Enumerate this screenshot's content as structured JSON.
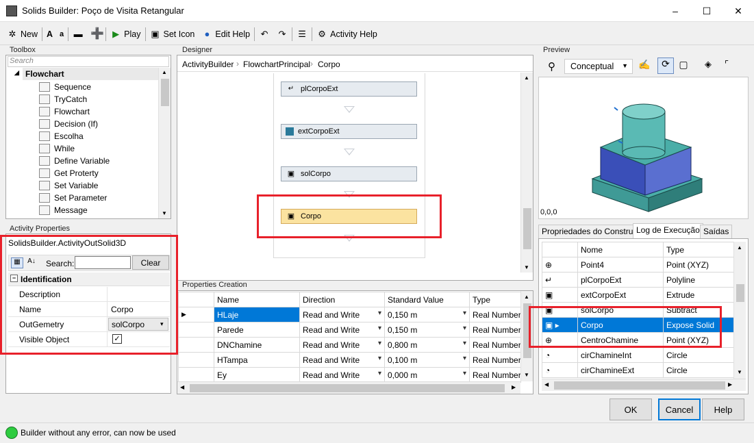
{
  "window": {
    "title": "Solids Builder: Poço de Visita Retangular"
  },
  "toolbar": {
    "new_label": "New",
    "font_a_upper": "A",
    "font_a_lower": "a",
    "play_label": "Play",
    "set_icon_label": "Set Icon",
    "edit_help_label": "Edit Help",
    "activity_help_label": "Activity Help"
  },
  "toolbox": {
    "label": "Toolbox",
    "search_placeholder": "Search",
    "group": "Flowchart",
    "items": [
      {
        "label": "Sequence",
        "icon": "sequence-icon"
      },
      {
        "label": "TryCatch",
        "icon": "trycatch-icon"
      },
      {
        "label": "Flowchart",
        "icon": "flowchart-icon"
      },
      {
        "label": "Decision (If)",
        "icon": "decision-icon"
      },
      {
        "label": "Escolha",
        "icon": "switch-icon"
      },
      {
        "label": "While",
        "icon": "while-icon"
      },
      {
        "label": "Define Variable",
        "icon": "variable-icon"
      },
      {
        "label": "Get Proterty",
        "icon": "get-property-icon"
      },
      {
        "label": "Set Variable",
        "icon": "set-variable-icon"
      },
      {
        "label": "Set Parameter",
        "icon": "set-parameter-icon"
      },
      {
        "label": "Message",
        "icon": "message-icon"
      }
    ]
  },
  "activity_properties": {
    "label": "Activity Properties",
    "type_name": "SolidsBuilder.ActivityOutSolid3D",
    "search_label": "Search:",
    "clear_label": "Clear",
    "category": "Identification",
    "rows": [
      {
        "name": "Description",
        "value": ""
      },
      {
        "name": "Name",
        "value": "Corpo"
      },
      {
        "name": "OutGemetry",
        "value": "solCorpo"
      },
      {
        "name": "Visible Object",
        "value": "✓"
      }
    ]
  },
  "designer": {
    "label": "Designer",
    "breadcrumb": [
      "ActivityBuilder",
      "FlowchartPrincipal",
      "Corpo"
    ],
    "nodes": [
      "plCorpoExt",
      "extCorpoExt",
      "solCorpo",
      "Corpo"
    ]
  },
  "properties_creation": {
    "label": "Properties Creation",
    "columns": [
      "Name",
      "Direction",
      "Standard Value",
      "Type"
    ],
    "rows": [
      {
        "name": "HLaje",
        "direction": "Read and Write",
        "value": "0,150 m",
        "type": "Real Number"
      },
      {
        "name": "Parede",
        "direction": "Read and Write",
        "value": "0,150 m",
        "type": "Real Number"
      },
      {
        "name": "DNChamine",
        "direction": "Read and Write",
        "value": "0,800 m",
        "type": "Real Number"
      },
      {
        "name": "HTampa",
        "direction": "Read and Write",
        "value": "0,100 m",
        "type": "Real Number"
      },
      {
        "name": "Ey",
        "direction": "Read and Write",
        "value": "0,000 m",
        "type": "Real Number"
      }
    ]
  },
  "preview": {
    "label": "Preview",
    "render_mode": "Conceptual",
    "coords": "0,0,0"
  },
  "tabs": [
    "Propriedades do Construtor",
    "Log de Execução",
    "Saídas"
  ],
  "log": {
    "columns": [
      "Nome",
      "Type"
    ],
    "rows": [
      {
        "name": "Point4",
        "type": "Point (XYZ)"
      },
      {
        "name": "plCorpoExt",
        "type": "Polyline"
      },
      {
        "name": "extCorpoExt",
        "type": "Extrude"
      },
      {
        "name": "solCorpo",
        "type": "Subtract"
      },
      {
        "name": "Corpo",
        "type": "Expose Solid"
      },
      {
        "name": "CentroChamine",
        "type": "Point (XYZ)"
      },
      {
        "name": "cirChamineInt",
        "type": "Circle"
      },
      {
        "name": "cirChamineExt",
        "type": "Circle"
      }
    ]
  },
  "buttons": {
    "ok": "OK",
    "cancel": "Cancel",
    "help": "Help"
  },
  "status": {
    "text": "Builder without any error, can now be used",
    "color": "#2ecc40"
  },
  "colors": {
    "selection": "#0078d7",
    "highlight_box": "#e8202a",
    "selected_node": "#fbe3a0"
  }
}
